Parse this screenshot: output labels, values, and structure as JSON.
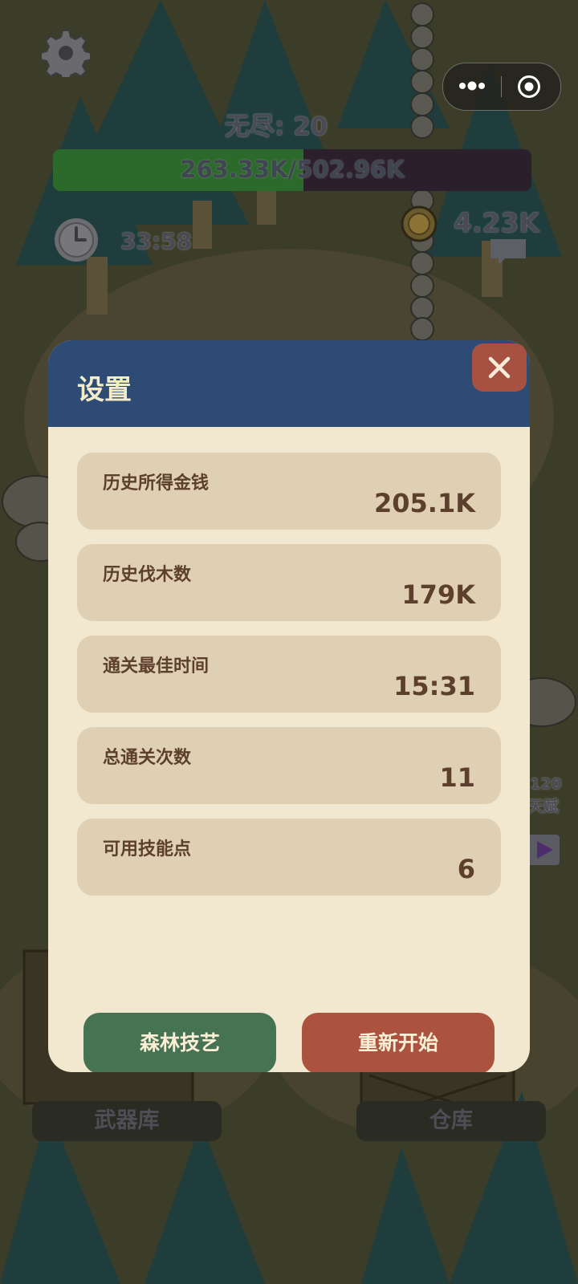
{
  "hud": {
    "mode_label": "无尽: 20",
    "hp_text": "263.33K/502.96K",
    "hp_fraction": 0.5236,
    "timer": "33:58",
    "coins": "4.23K",
    "talent_count": "120",
    "talent_label": "天赋"
  },
  "bottom_nav": {
    "armory": "武器库",
    "warehouse": "仓库"
  },
  "capsule": {
    "more_icon": "more-dots-icon",
    "close_icon": "target-circle-icon"
  },
  "modal": {
    "title": "设置",
    "stats": [
      {
        "label": "历史所得金钱",
        "value": "205.1K"
      },
      {
        "label": "历史伐木数",
        "value": "179K"
      },
      {
        "label": "通关最佳时间",
        "value": "15:31"
      },
      {
        "label": "总通关次数",
        "value": "11"
      },
      {
        "label": "可用技能点",
        "value": "6"
      }
    ],
    "buttons": {
      "forest_skill": "森林技艺",
      "restart": "重新开始"
    }
  },
  "colors": {
    "header": "#2d4b75",
    "panel": "#f2e8d0",
    "card": "#e0d0b3",
    "text": "#5c3f2c",
    "close": "#a75142",
    "green_button": "#457354",
    "red_button": "#ac533f"
  }
}
